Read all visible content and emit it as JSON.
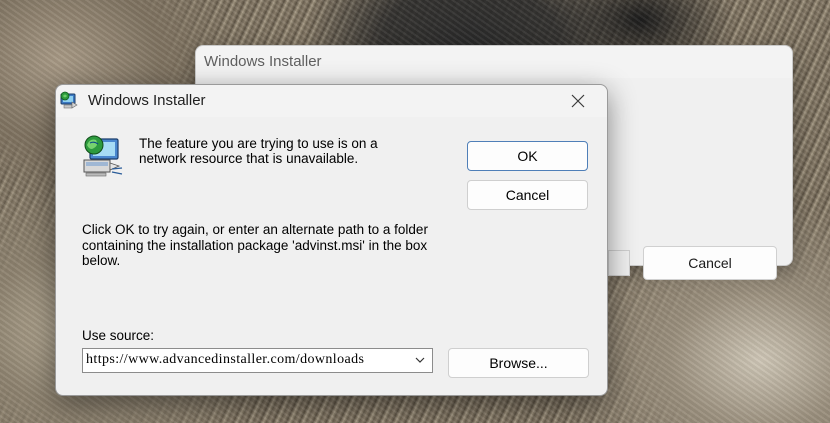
{
  "back_window": {
    "title": "Windows Installer",
    "cancel_label": "Cancel"
  },
  "dialog": {
    "title": "Windows Installer",
    "close_icon": "close-icon",
    "message": "The feature you are trying to use is on a network resource that is unavailable.",
    "ok_label": "OK",
    "cancel_label": "Cancel",
    "instructions": "Click OK to try again, or enter an alternate path to a folder containing the installation package 'advinst.msi' in the box below.",
    "source_label": "Use source:",
    "source_value": "https://www.advancedinstaller.com/downloads",
    "browse_label": "Browse...",
    "icons": {
      "title": "windows-installer-icon",
      "main": "network-computer-icon",
      "dropdown": "chevron-down-icon"
    }
  },
  "colors": {
    "ok_border": "#4f7fb8",
    "dialog_bg": "#f0f0f0",
    "titlebar_bg": "#f3f3f3"
  }
}
